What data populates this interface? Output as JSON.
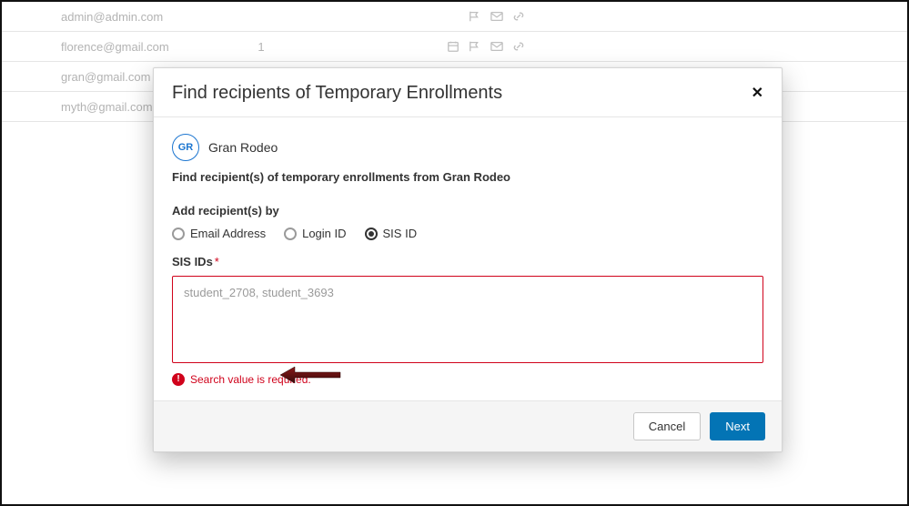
{
  "bg_rows": [
    {
      "email": "admin@admin.com",
      "count": "",
      "icons": [
        "flag-icon",
        "mail-icon",
        "link-icon"
      ]
    },
    {
      "email": "florence@gmail.com",
      "count": "1",
      "icons": [
        "calendar-icon",
        "flag-icon",
        "mail-icon",
        "link-icon"
      ]
    },
    {
      "email": "gran@gmail.com",
      "count": "",
      "icons": []
    },
    {
      "email": "myth@gmail.com",
      "count": "",
      "icons": []
    }
  ],
  "modal": {
    "title": "Find recipients of Temporary Enrollments",
    "close_glyph": "✕",
    "user": {
      "initials": "GR",
      "name": "Gran Rodeo"
    },
    "subtitle": "Find recipient(s) of temporary enrollments from Gran Rodeo",
    "add_by_label": "Add recipient(s) by",
    "radio": {
      "email": "Email Address",
      "login": "Login ID",
      "sis": "SIS ID",
      "selected": "sis"
    },
    "field_label": "SIS IDs",
    "required_mark": "*",
    "textarea_placeholder": "student_2708, student_3693",
    "textarea_value": "",
    "error_msg": "Search value is required.",
    "footer": {
      "cancel": "Cancel",
      "next": "Next"
    }
  }
}
